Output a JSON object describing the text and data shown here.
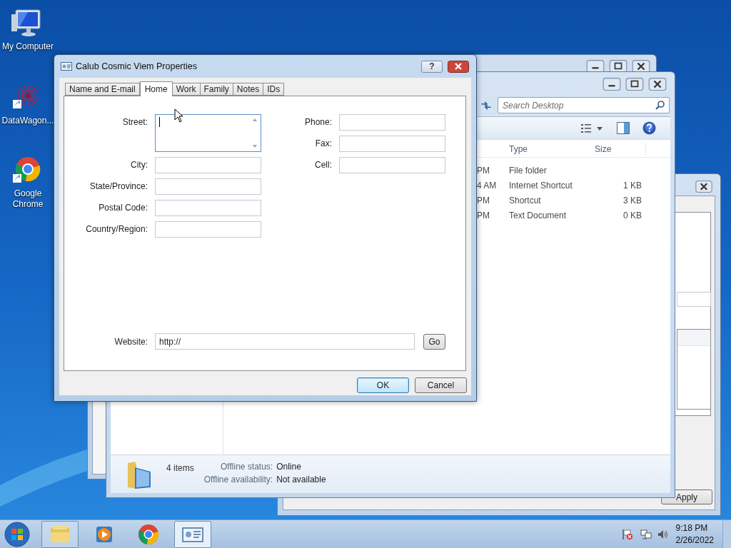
{
  "desktop_icons": [
    {
      "label": "My Computer",
      "kind": "computer"
    },
    {
      "label": "DataWagon...",
      "kind": "shortcut"
    },
    {
      "label": "Google Chrome",
      "kind": "chrome"
    }
  ],
  "rear_dialog": {
    "buttons": [
      {
        "label": "Apply"
      }
    ]
  },
  "explorer": {
    "search": {
      "placeholder": "Search Desktop"
    },
    "columns": [
      "Type",
      "Size"
    ],
    "rows": [
      {
        "date": "PM",
        "type": "File folder"
      },
      {
        "date": "4 AM",
        "type": "Internet Shortcut",
        "size": "1 KB"
      },
      {
        "date": "PM",
        "type": "Shortcut",
        "size": "3 KB"
      },
      {
        "date": "PM",
        "type": "Text Document",
        "size": "0 KB"
      }
    ],
    "details": {
      "count": "4 items",
      "fields": [
        {
          "label": "Offline status:",
          "value": "Online"
        },
        {
          "label": "Offline availability:",
          "value": "Not available"
        }
      ]
    }
  },
  "dialog": {
    "title": "Calub Cosmic Viem Properties",
    "help": "?",
    "tabs": [
      {
        "label": "Name and E-mail",
        "selected": false
      },
      {
        "label": "Home",
        "selected": true
      },
      {
        "label": "Work",
        "selected": false
      },
      {
        "label": "Family",
        "selected": false
      },
      {
        "label": "Notes",
        "selected": false
      },
      {
        "label": "IDs",
        "selected": false
      }
    ],
    "left_fields": [
      {
        "label": "Street:",
        "kind": "multiline",
        "focused": true
      },
      {
        "label": "City:",
        "kind": "text",
        "focused": false
      },
      {
        "label": "State/Province:",
        "kind": "text",
        "focused": false
      },
      {
        "label": "Postal Code:",
        "kind": "text",
        "focused": false
      },
      {
        "label": "Country/Region:",
        "kind": "text",
        "focused": false
      }
    ],
    "right_fields": [
      {
        "label": "Phone:",
        "focused": false
      },
      {
        "label": "Fax:",
        "focused": false
      },
      {
        "label": "Cell:",
        "focused": false
      }
    ],
    "website": {
      "label": "Website:",
      "value": "http://"
    },
    "go_button": "Go",
    "buttons": [
      {
        "label": "OK",
        "default": true
      },
      {
        "label": "Cancel",
        "default": false
      }
    ]
  },
  "taskbar": {
    "items": [
      {
        "kind": "explorer",
        "open": true,
        "active": false
      },
      {
        "kind": "media",
        "open": false,
        "active": false
      },
      {
        "kind": "chrome",
        "open": false,
        "active": false
      },
      {
        "kind": "contact",
        "open": true,
        "active": true
      }
    ],
    "clock": {
      "time": "9:18 PM",
      "date": "2/26/2022"
    }
  }
}
